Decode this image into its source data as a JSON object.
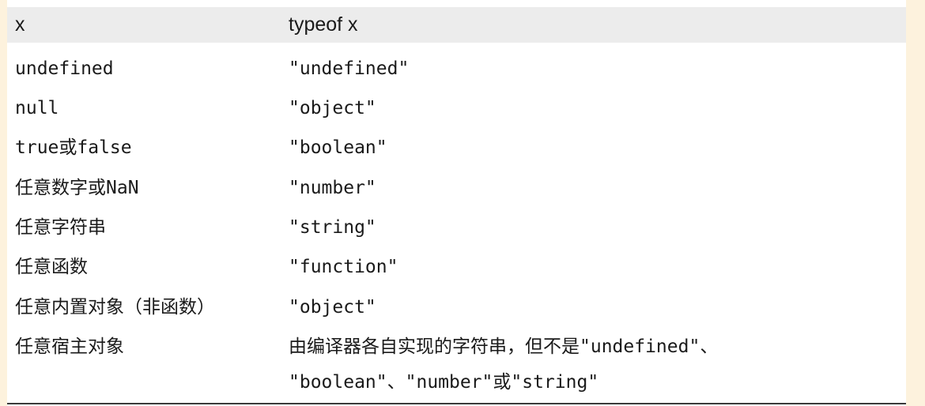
{
  "table": {
    "headers": [
      "x",
      "typeof x"
    ],
    "rows": [
      {
        "x": "undefined",
        "typeof": "\"undefined\""
      },
      {
        "x": "null",
        "typeof": "\"object\""
      },
      {
        "x": "true或false",
        "typeof": "\"boolean\""
      },
      {
        "x": "任意数字或NaN",
        "typeof": "\"number\""
      },
      {
        "x": "任意字符串",
        "typeof": "\"string\""
      },
      {
        "x": "任意函数",
        "typeof": "\"function\""
      },
      {
        "x": "任意内置对象（非函数）",
        "typeof": "\"object\""
      },
      {
        "x": "任意宿主对象",
        "typeof_lines": [
          "由编译器各自实现的字符串，但不是\"undefined\"、",
          "\"boolean\"、\"number\"或\"string\""
        ]
      }
    ]
  }
}
